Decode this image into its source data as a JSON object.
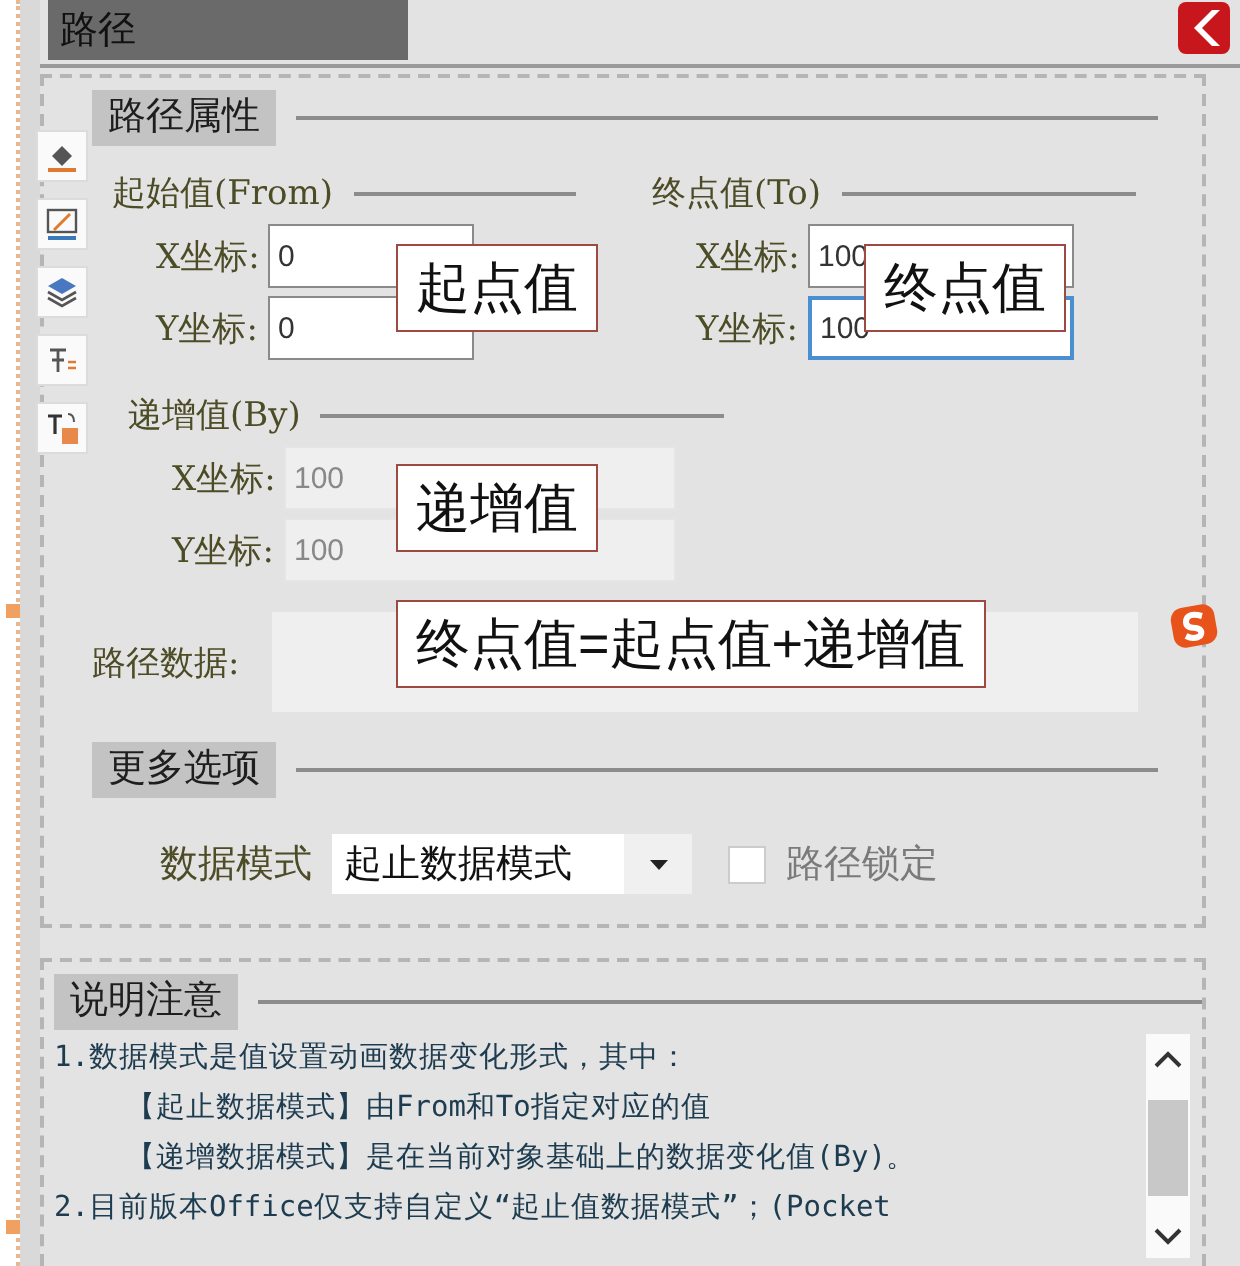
{
  "panel": {
    "title": "路径",
    "selected": true
  },
  "path_properties": {
    "header": "路径属性",
    "groups": [
      {
        "kind": "from",
        "title": "起始值(From)",
        "disabled": false,
        "fields": [
          {
            "label": "X坐标:",
            "value": "0",
            "focused": false
          },
          {
            "label": "Y坐标:",
            "value": "0",
            "focused": false
          }
        ]
      },
      {
        "kind": "to",
        "title": "终点值(To)",
        "disabled": false,
        "fields": [
          {
            "label": "X坐标:",
            "value": "100",
            "focused": false
          },
          {
            "label": "Y坐标:",
            "value": "100",
            "focused": true
          }
        ]
      },
      {
        "kind": "by",
        "title": "递增值(By)",
        "disabled": true,
        "fields": [
          {
            "label": "X坐标:",
            "value": "100",
            "focused": false
          },
          {
            "label": "Y坐标:",
            "value": "100",
            "focused": false
          }
        ]
      }
    ],
    "path_data_label": "路径数据:"
  },
  "more_options": {
    "header": "更多选项",
    "mode_label": "数据模式",
    "mode_value": "起止数据模式",
    "lock": {
      "label": "路径锁定",
      "checked": false
    }
  },
  "notes": {
    "header": "说明注意",
    "lines": [
      {
        "kind": "item",
        "text": "1.数据模式是值设置动画数据变化形式，其中："
      },
      {
        "kind": "sub",
        "text": "【起止数据模式】由From和To指定对应的值"
      },
      {
        "kind": "sub",
        "text": "【递增数据模式】是在当前对象基础上的数据变化值(By)。"
      },
      {
        "kind": "item",
        "text": "2.目前版本Office仅支持自定义“起止值数据模式”；(Pocket"
      }
    ]
  },
  "callouts": [
    {
      "text": "起点值"
    },
    {
      "text": "终点值"
    },
    {
      "text": "递增值"
    },
    {
      "text": "终点值=起点值+递增值"
    }
  ]
}
